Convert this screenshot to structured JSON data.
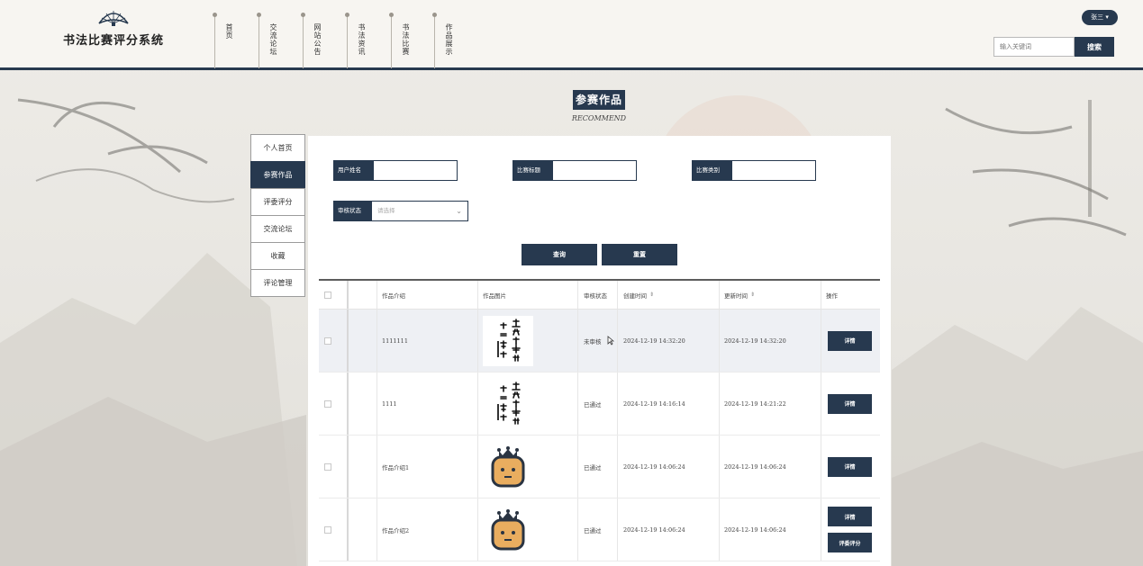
{
  "app": {
    "title": "书法比赛评分系统"
  },
  "nav": [
    {
      "label": "首页"
    },
    {
      "label": "交流论坛"
    },
    {
      "label": "网站公告"
    },
    {
      "label": "书法资讯"
    },
    {
      "label": "书法比赛"
    },
    {
      "label": "作品展示"
    }
  ],
  "user": {
    "name": "张三"
  },
  "search": {
    "placeholder": "输入关键词",
    "button": "搜索"
  },
  "section": {
    "title": "参赛作品",
    "subtitle": "RECOMMEND"
  },
  "side_menu": [
    {
      "label": "个人首页",
      "active": false
    },
    {
      "label": "参赛作品",
      "active": true
    },
    {
      "label": "评委评分",
      "active": false
    },
    {
      "label": "交流论坛",
      "active": false
    },
    {
      "label": "收藏",
      "active": false
    },
    {
      "label": "评论管理",
      "active": false
    }
  ],
  "filters": {
    "username_label": "用户姓名",
    "title_label": "比赛标题",
    "category_label": "比赛类别",
    "status_label": "审核状态",
    "status_placeholder": "请选择",
    "query_button": "查询",
    "reset_button": "重置"
  },
  "table": {
    "headers": {
      "intro": "作品介绍",
      "image": "作品图片",
      "status": "审核状态",
      "created": "创建时间",
      "updated": "更新时间",
      "ops": "操作"
    },
    "detail_label": "详情",
    "score_label": "评委评分",
    "rows": [
      {
        "intro": "1111111",
        "image": "calligraphy",
        "status": "未审核",
        "created": "2024-12-19 14:32:20",
        "updated": "2024-12-19 14:32:20"
      },
      {
        "intro": "1111",
        "image": "calligraphy",
        "status": "已通过",
        "created": "2024-12-19 14:16:14",
        "updated": "2024-12-19 14:21:22"
      },
      {
        "intro": "作品介绍1",
        "image": "robot",
        "status": "已通过",
        "created": "2024-12-19 14:06:24",
        "updated": "2024-12-19 14:06:24"
      },
      {
        "intro": "作品介绍2",
        "image": "robot",
        "status": "已通过",
        "created": "2024-12-19 14:06:24",
        "updated": "2024-12-19 14:06:24"
      }
    ]
  },
  "colors": {
    "primary": "#27394f",
    "row_highlight": "#eef0f4"
  },
  "icons": {
    "logo": "fan-icon",
    "cursor": "mouse-pointer-icon"
  }
}
